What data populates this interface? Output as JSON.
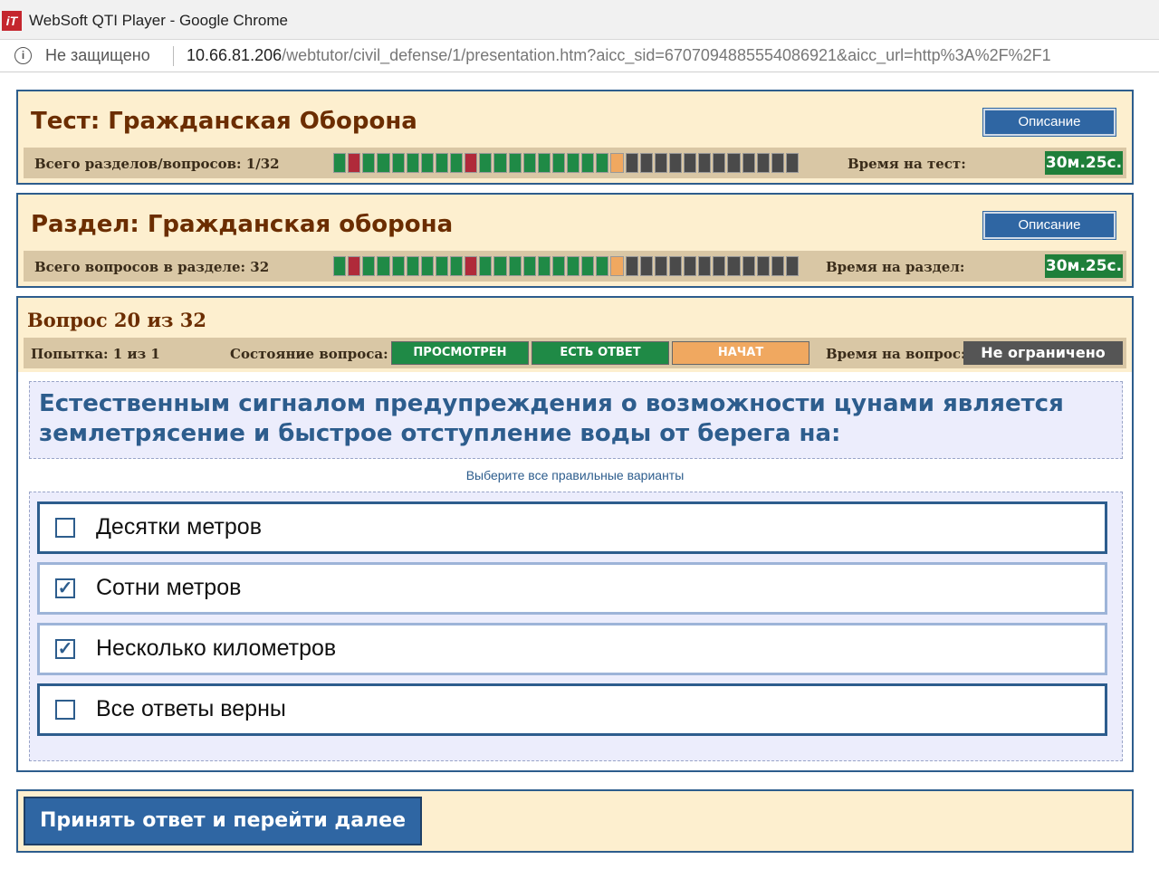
{
  "window": {
    "title": "WebSoft QTI Player - Google Chrome",
    "logo_text": "iT"
  },
  "address_bar": {
    "security_text": "Не защищено",
    "url_host": "10.66.81.206",
    "url_path": "/webtutor/civil_defense/1/presentation.htm?aicc_sid=6707094885554086921&aicc_url=http%3A%2F%2F1"
  },
  "test_panel": {
    "title": "Тест: Гражданская Оборона",
    "description_button": "Описание",
    "progress_label": "Всего разделов/вопросов: 1/32",
    "time_label": "Время на тест:",
    "timer": "30м.25с."
  },
  "section_panel": {
    "title": "Раздел: Гражданская оборона",
    "description_button": "Описание",
    "progress_label": "Всего вопросов в разделе: 32",
    "time_label": "Время на раздел:",
    "timer": "30м.25с."
  },
  "progress_segments": [
    "green",
    "red",
    "green",
    "green",
    "green",
    "green",
    "green",
    "green",
    "green",
    "red",
    "green",
    "green",
    "green",
    "green",
    "green",
    "green",
    "green",
    "green",
    "green",
    "orange",
    "gray",
    "gray",
    "gray",
    "gray",
    "gray",
    "gray",
    "gray",
    "gray",
    "gray",
    "gray",
    "gray",
    "gray"
  ],
  "colors": {
    "green": "#1f8a46",
    "red": "#b02a3a",
    "orange": "#f0a860",
    "gray": "#4a4a4a",
    "accent": "#2d5d8d",
    "panel_bg": "#fdefcf"
  },
  "question_panel": {
    "title": "Вопрос 20 из 32",
    "attempt": "Попытка: 1 из 1",
    "state_label": "Состояние вопроса:",
    "states": [
      {
        "label": "ПРОСМОТРЕН",
        "color": "#1f8a46"
      },
      {
        "label": "ЕСТЬ ОТВЕТ",
        "color": "#1f8a46"
      },
      {
        "label": "НАЧАТ",
        "color": "#f0a860"
      }
    ],
    "time_label": "Время на вопрос:",
    "time_value": "Не ограничено",
    "question_text": "Естественным сигналом предупреждения о возможности цунами является землетрясение и быстрое отступление воды от берега на:",
    "hint": "Выберите все правильные варианты",
    "choices": [
      {
        "label": "Десятки метров",
        "checked": false
      },
      {
        "label": "Сотни метров",
        "checked": true
      },
      {
        "label": "Несколько километров",
        "checked": true
      },
      {
        "label": "Все ответы верны",
        "checked": false
      }
    ]
  },
  "submit": {
    "label": "Принять ответ и перейти далее"
  }
}
